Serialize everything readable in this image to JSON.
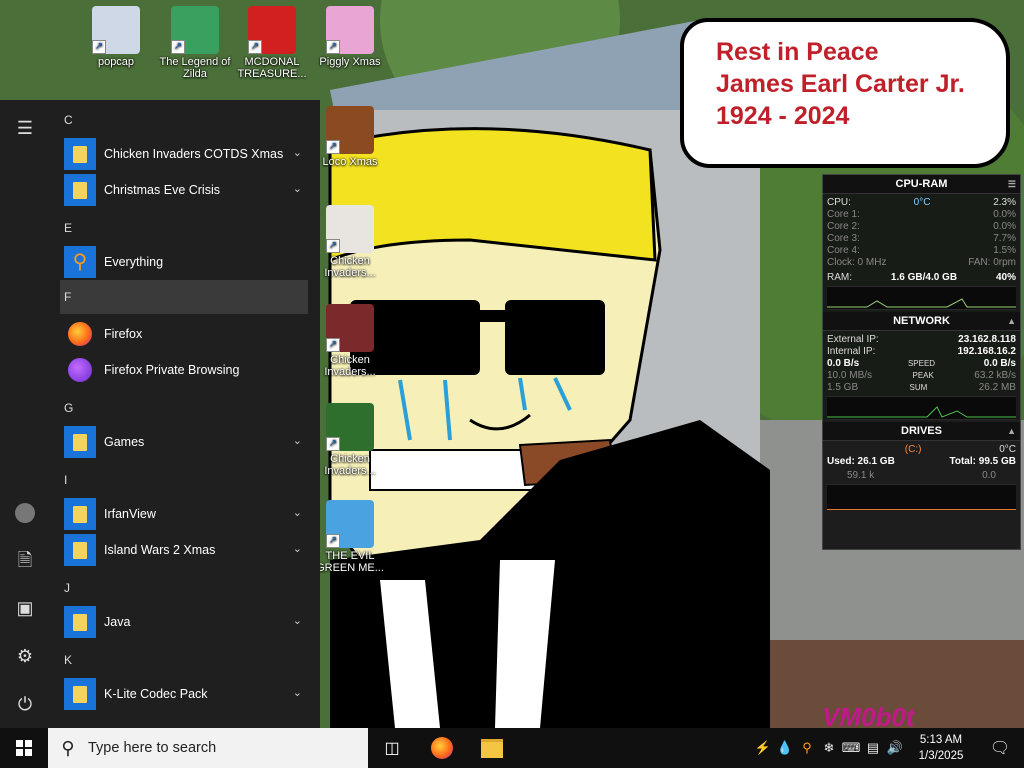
{
  "desktop": {
    "icons": [
      {
        "label": "popcap",
        "icon": "popcap-icon",
        "color": "#cfd8e6"
      },
      {
        "label": "The Legend of Zilda",
        "icon": "legend-of-zilda-icon",
        "color": "#3aa060"
      },
      {
        "label": "MCDONAL TREASURE...",
        "icon": "mcdonalds-icon",
        "color": "#d21f1f"
      },
      {
        "label": "Piggly Xmas",
        "icon": "piggly-xmas-icon",
        "color": "#e9a6d4"
      },
      {
        "label": "Loco Xmas",
        "icon": "loco-xmas-icon",
        "color": "#8b4a1f"
      },
      {
        "label": "Chicken Invaders...",
        "icon": "chicken-invaders-icon",
        "color": "#e8e4e0"
      },
      {
        "label": "Chicken Invaders...",
        "icon": "chicken-invaders-icon",
        "color": "#7a2a2a"
      },
      {
        "label": "Chicken Invaders...",
        "icon": "chicken-invaders-icon",
        "color": "#2e6f2e"
      },
      {
        "label": "THE EVIL GREEN ME...",
        "icon": "evil-green-icon",
        "color": "#4aa2e0"
      }
    ]
  },
  "bubble": {
    "lines": [
      "Rest in Peace",
      "James Earl Carter Jr.",
      "1924 - 2024"
    ]
  },
  "widget": {
    "cpu_ram": {
      "title": "CPU-RAM",
      "cpu_label": "CPU:",
      "cpu_temp": "0°C",
      "cpu_value": "2.3%",
      "cores": [
        {
          "label": "Core 1:",
          "value": "0.0%"
        },
        {
          "label": "Core 2:",
          "value": "0.0%"
        },
        {
          "label": "Core 3:",
          "value": "7.7%"
        },
        {
          "label": "Core 4:",
          "value": "1.5%"
        }
      ],
      "clock": "Clock: 0 MHz",
      "fan": "FAN: 0rpm",
      "ram_label": "RAM:",
      "ram_used": "1.6 GB/4.0 GB",
      "ram_pct": "40%"
    },
    "network": {
      "title": "NETWORK",
      "external_label": "External IP:",
      "external_ip": "23.162.8.118",
      "internal_label": "Internal IP:",
      "internal_ip": "192.168.16.2",
      "speed_left": "0.0 B/s",
      "speed_label": "SPEED",
      "speed_right": "0.0 B/s",
      "peak_left": "10.0 MB/s",
      "peak_label": "PEAK",
      "peak_right": "63.2 kB/s",
      "sum_left": "1.5 GB",
      "sum_label": "SUM",
      "sum_right": "26.2 MB"
    },
    "drives": {
      "title": "DRIVES",
      "drive": "(C:)",
      "temp": "0°C",
      "used": "Used: 26.1 GB",
      "total": "Total: 99.5 GB",
      "read": "59.1 k",
      "write": "0.0"
    }
  },
  "start_menu": {
    "sections": [
      {
        "letter": "C",
        "items": [
          {
            "label": "Chicken Invaders COTDS Xmas",
            "type": "folder",
            "expand": true
          },
          {
            "label": "Christmas Eve Crisis",
            "type": "folder",
            "expand": true
          }
        ]
      },
      {
        "letter": "E",
        "items": [
          {
            "label": "Everything",
            "type": "app",
            "icon": "everything-icon"
          }
        ]
      },
      {
        "letter": "F",
        "highlight": true,
        "items": [
          {
            "label": "Firefox",
            "type": "app",
            "icon": "firefox-icon"
          },
          {
            "label": "Firefox Private Browsing",
            "type": "app",
            "icon": "firefox-private-icon"
          }
        ]
      },
      {
        "letter": "G",
        "items": [
          {
            "label": "Games",
            "type": "folder",
            "expand": true
          }
        ]
      },
      {
        "letter": "I",
        "items": [
          {
            "label": "IrfanView",
            "type": "folder",
            "expand": true
          },
          {
            "label": "Island Wars 2 Xmas",
            "type": "folder",
            "expand": true
          }
        ]
      },
      {
        "letter": "J",
        "items": [
          {
            "label": "Java",
            "type": "folder",
            "expand": true
          }
        ]
      },
      {
        "letter": "K",
        "items": [
          {
            "label": "K-Lite Codec Pack",
            "type": "folder",
            "expand": true
          }
        ]
      }
    ]
  },
  "taskbar": {
    "search_placeholder": "Type here to search",
    "time": "5:13 AM",
    "date": "1/3/2025"
  },
  "signature": "VM0b0t"
}
